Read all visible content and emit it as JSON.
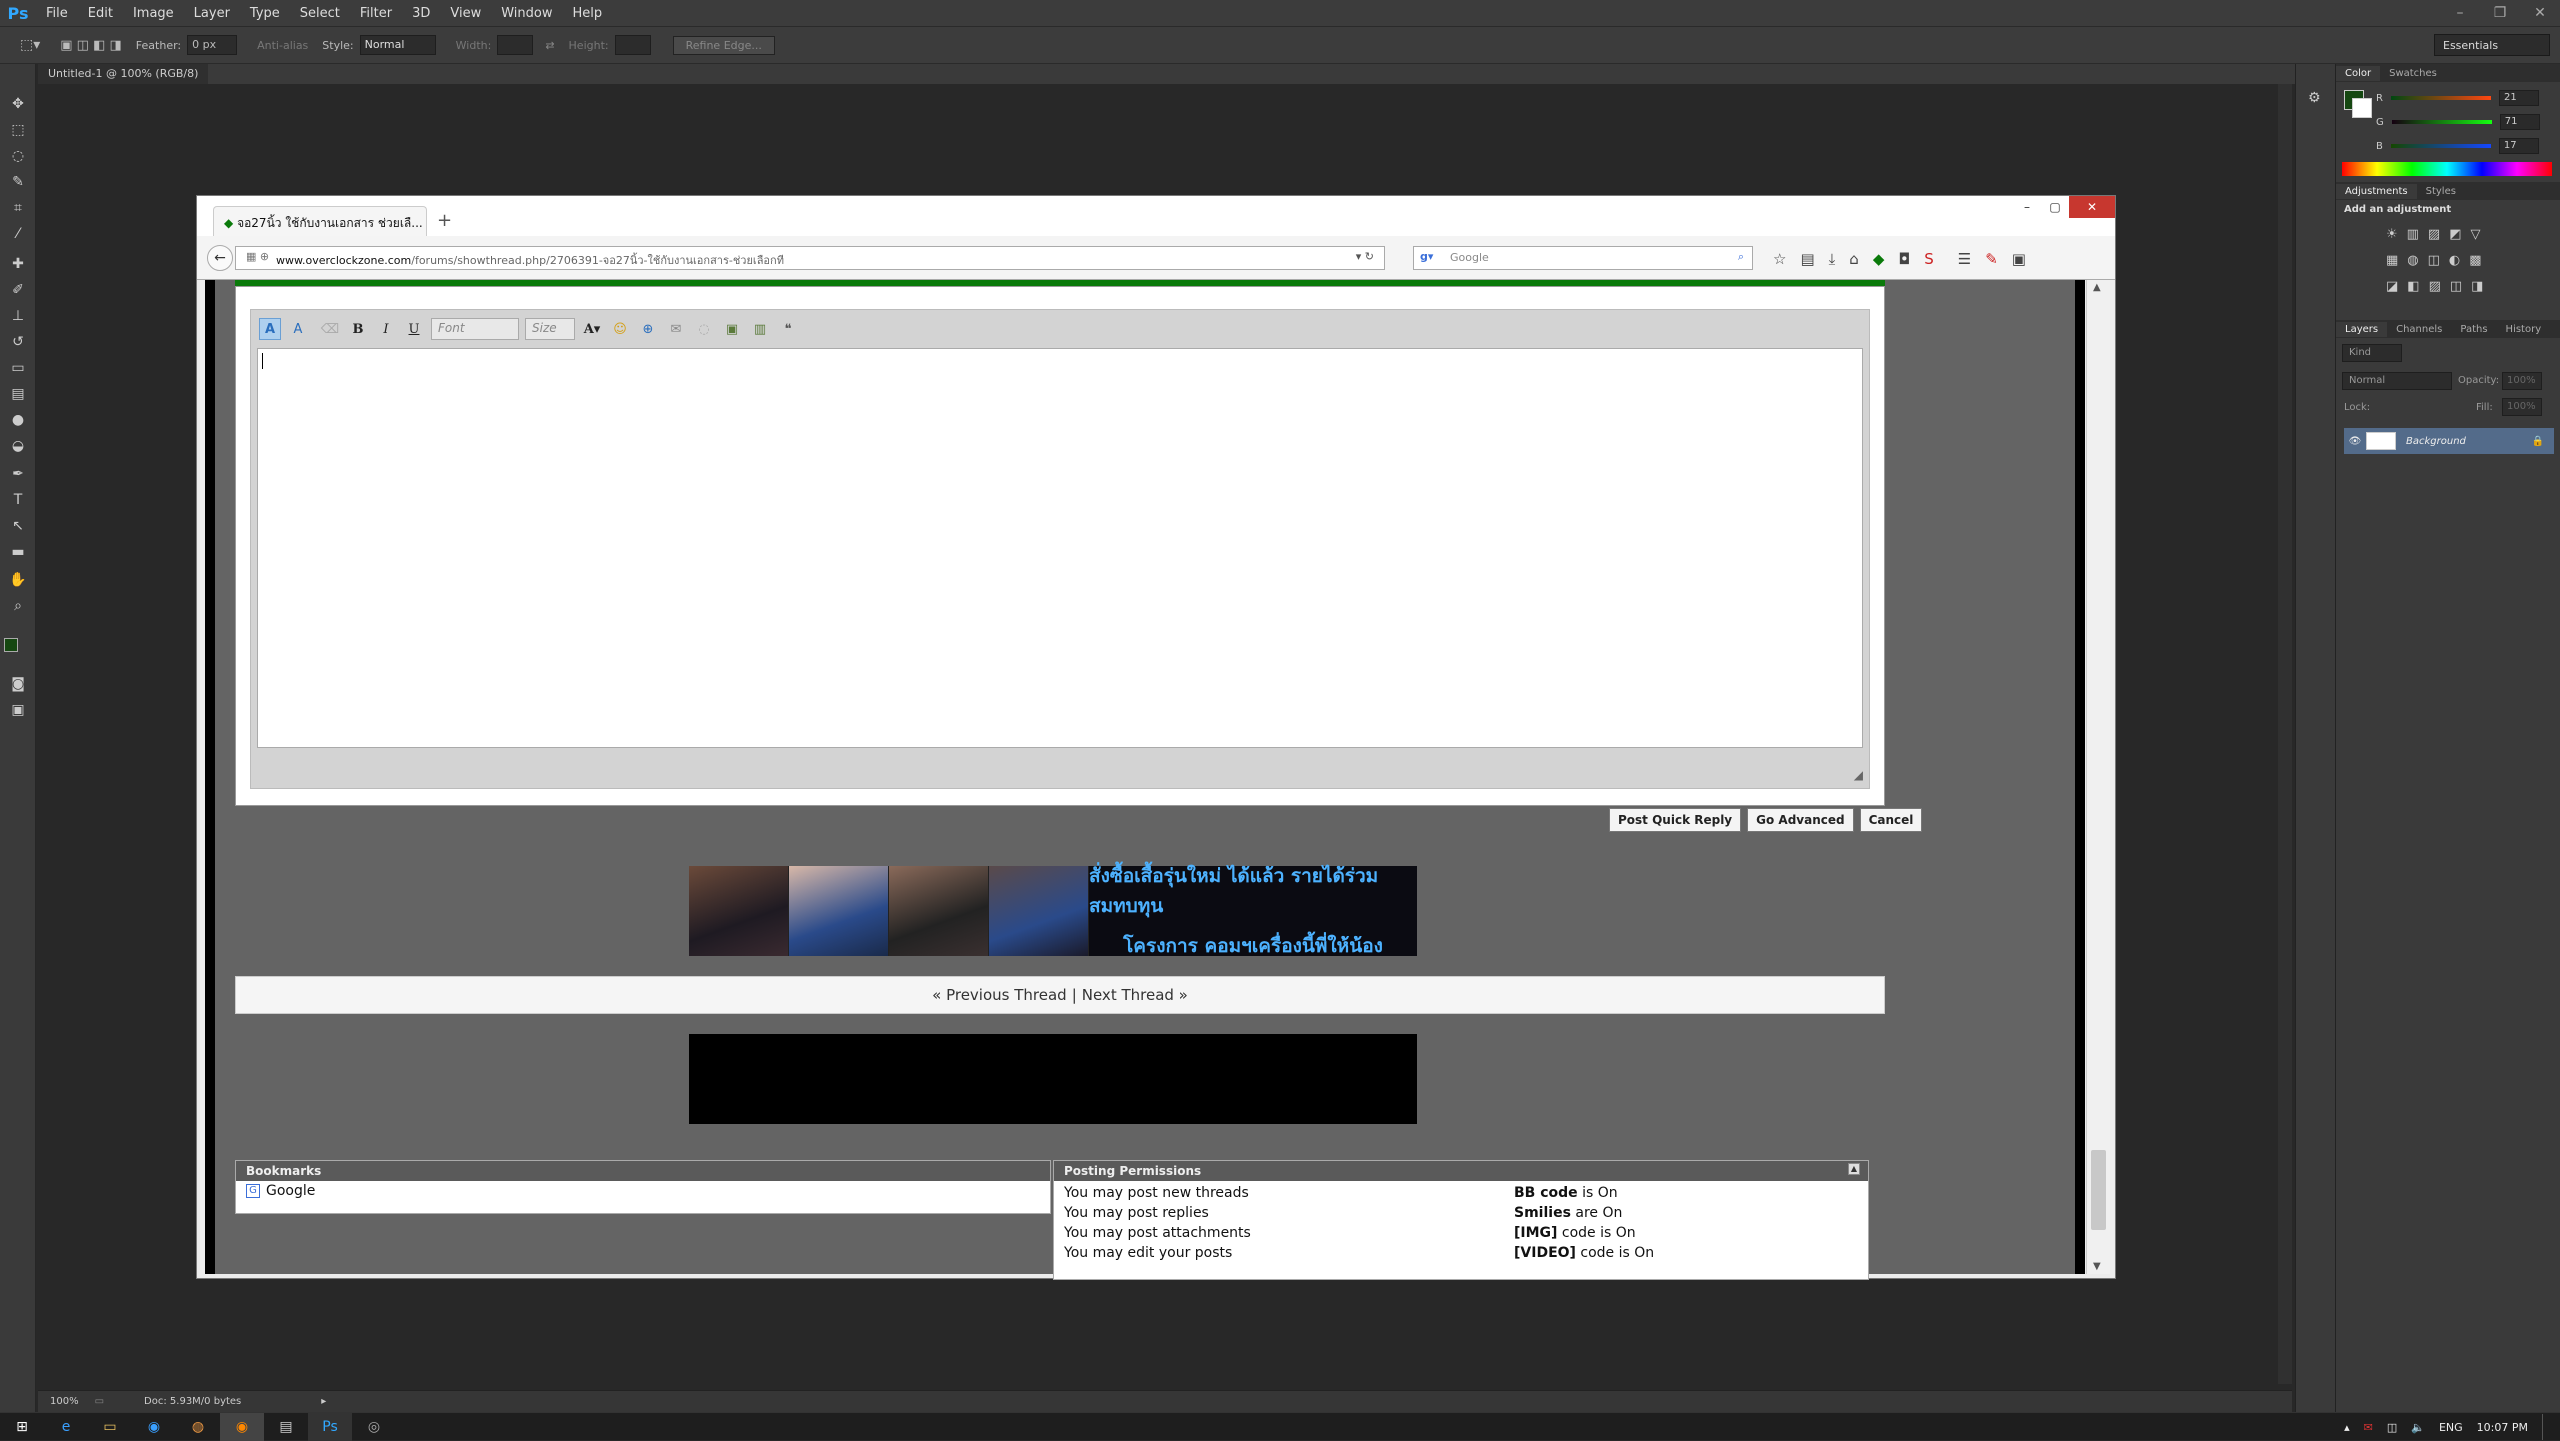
{
  "ps": {
    "menus": [
      "File",
      "Edit",
      "Image",
      "Layer",
      "Type",
      "Select",
      "Filter",
      "3D",
      "View",
      "Window",
      "Help"
    ],
    "logo": "Ps",
    "options": {
      "feather_label": "Feather:",
      "feather_value": "0 px",
      "antialias": "Anti-alias",
      "style_label": "Style:",
      "style_value": "Normal",
      "width_label": "Width:",
      "height_label": "Height:",
      "refine": "Refine Edge..."
    },
    "workspace": "Essentials",
    "doc_tab": "Untitled-1 @ 100% (RGB/8)",
    "status_zoom": "100%",
    "status_doc": "Doc: 5.93M/0 bytes",
    "panels": {
      "color_tabs": [
        "Color",
        "Swatches"
      ],
      "r": "21",
      "g": "71",
      "b": "17",
      "r_label": "R",
      "g_label": "G",
      "b_label": "B",
      "adjust_tabs": [
        "Adjustments",
        "Styles"
      ],
      "add_adjustment": "Add an adjustment",
      "layer_tabs": [
        "Layers",
        "Channels",
        "Paths",
        "History"
      ],
      "kind": "Kind",
      "blend": "Normal",
      "opacity_label": "Opacity:",
      "opacity_value": "100%",
      "lock_label": "Lock:",
      "fill_label": "Fill:",
      "fill_value": "100%",
      "layer_name": "Background"
    },
    "colors": {
      "fg": "#154711",
      "accent": "#31a8ff"
    }
  },
  "taskbar": {
    "lang": "ENG",
    "time": "10:07 PM"
  },
  "firefox": {
    "tab_title": "จอ27นิ้ว ใช้กับงานเอกสาร ช่วยเลื...",
    "url_host": "www.overclockzone.com",
    "url_path": "/forums/showthread.php/2706391-จอ27นิ้ว-ใช้กับงานเอกสาร-ช่วยเลือกที",
    "search_placeholder": "Google",
    "editor": {
      "font_placeholder": "Font",
      "size_placeholder": "Size"
    },
    "buttons": {
      "post": "Post Quick Reply",
      "advanced": "Go Advanced",
      "cancel": "Cancel"
    },
    "banner": {
      "line1": "สั่งซื้อเสื้อรุ่นใหม่ ได้แล้ว รายได้ร่วมสมทบทุน",
      "line2": "โครงการ คอมฯเครื่องนี้พี่ให้น้อง"
    },
    "threadnav": {
      "prev": "« Previous Thread",
      "sep": "|",
      "next": "Next Thread »"
    },
    "bookmarks": {
      "title": "Bookmarks",
      "item": "Google"
    },
    "permissions": {
      "title": "Posting Permissions",
      "left": [
        "You may post new threads",
        "You may post replies",
        "You may post attachments",
        "You may edit your posts"
      ],
      "right_bold": [
        "BB code",
        "Smilies",
        "[IMG]",
        "[VIDEO]"
      ],
      "right_rest": [
        "is On",
        "are On",
        "code is On",
        "code is On"
      ]
    }
  }
}
